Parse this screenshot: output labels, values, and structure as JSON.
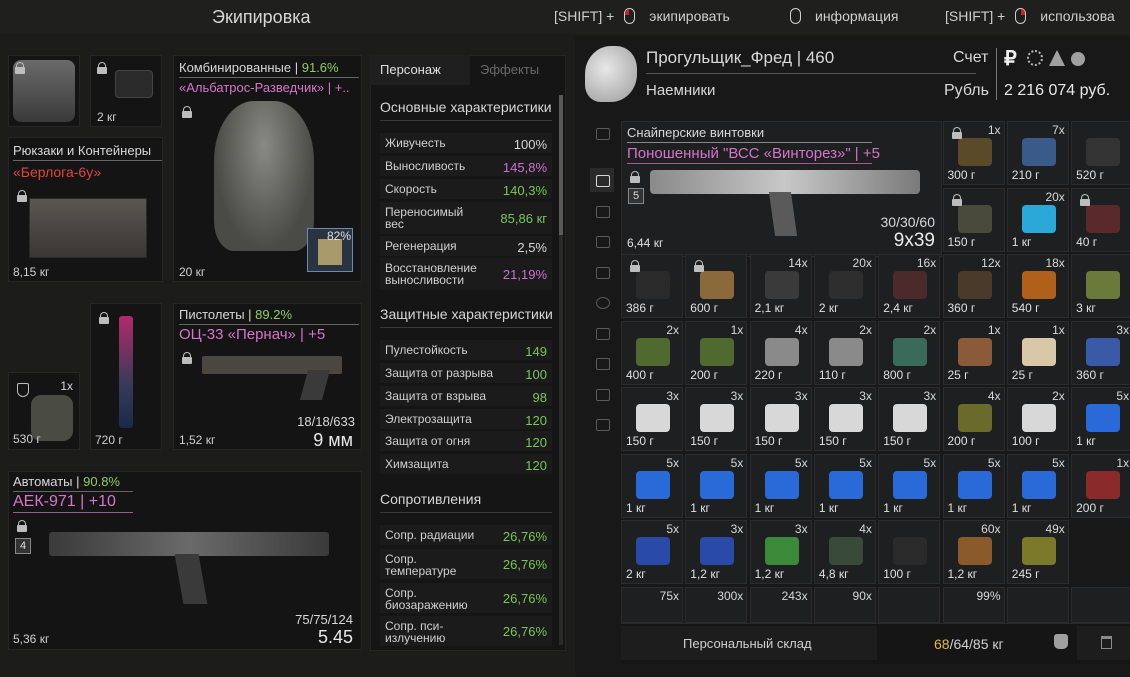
{
  "header": {
    "title": "Экипировка",
    "hints": [
      {
        "prefix": "[SHIFT] +",
        "mouse": "left",
        "label": "экипировать"
      },
      {
        "prefix": "",
        "mouse": "none",
        "label": "информация"
      },
      {
        "prefix": "[SHIFT] +",
        "mouse": "right",
        "label": "использова"
      }
    ]
  },
  "equipment": {
    "mask_weight": "",
    "nvd_weight": "2 кг",
    "armor": {
      "category": "Комбинированные",
      "durability": "91.6%",
      "name": "«Альбатрос-Разведчик» | +..",
      "weight": "20 кг",
      "container_fill": "82%"
    },
    "backpack": {
      "category": "Рюкзаки и Контейнеры",
      "name": "«Берлога-6у»",
      "weight": "8,15 кг"
    },
    "artifact": {
      "count": "1x",
      "weight": "530 г"
    },
    "knife": {
      "weight": "720 г"
    },
    "pistol": {
      "category": "Пистолеты",
      "durability": "89.2%",
      "name": "ОЦ-33 «Пернач» | +5",
      "weight": "1,52 кг",
      "ammo": "18/18/633",
      "caliber": "9 мм"
    },
    "rifle": {
      "category": "Автоматы",
      "durability": "90.8%",
      "name": "АЕК-971 | +10",
      "weight": "5,36 кг",
      "ammo": "75/75/124",
      "caliber": "5.45",
      "badge": "4"
    }
  },
  "stats": {
    "tabs": [
      "Персонаж",
      "Эффекты"
    ],
    "main_title": "Основные характеристики",
    "main": [
      {
        "label": "Живучесть",
        "value": "100%",
        "color": "white"
      },
      {
        "label": "Выносливость",
        "value": "145,8%",
        "color": "magenta"
      },
      {
        "label": "Скорость",
        "value": "140,3%",
        "color": "green"
      },
      {
        "label": "Переносимый вес",
        "value": "85,86 кг",
        "color": "green"
      },
      {
        "label": "Регенерация",
        "value": "2,5%",
        "color": "white"
      },
      {
        "label": "Восстановление выносливости",
        "value": "21,19%",
        "color": "magenta"
      }
    ],
    "protect_title": "Защитные характеристики",
    "protect": [
      {
        "label": "Пулестойкость",
        "value": "149"
      },
      {
        "label": "Защита от разрыва",
        "value": "100"
      },
      {
        "label": "Защита от взрыва",
        "value": "98"
      },
      {
        "label": "Электрозащита",
        "value": "120"
      },
      {
        "label": "Защита от огня",
        "value": "120"
      },
      {
        "label": "Химзащита",
        "value": "120"
      }
    ],
    "resist_title": "Сопротивления",
    "resist": [
      {
        "label": "Сопр. радиации",
        "value": "26,76%"
      },
      {
        "label": "Сопр. температуре",
        "value": "26,76%"
      },
      {
        "label": "Сопр. биозаражению",
        "value": "26,76%"
      },
      {
        "label": "Сопр. пси-излучению",
        "value": "26,76%"
      }
    ]
  },
  "player": {
    "name": "Прогульщик_Фред | 460",
    "faction": "Наемники",
    "account_label": "Счет",
    "currency_label": "Рубль",
    "balance": "2 216 074 руб."
  },
  "inventory": {
    "featured": {
      "category": "Снайперские винтовки",
      "name": "Поношенный \"ВСС «Винторез»\" | +5",
      "weight": "6,44 кг",
      "ammo": "30/30/60",
      "caliber": "9x39",
      "badge": "5"
    },
    "cells": [
      {
        "count": "1x",
        "weight": "300 г",
        "color": "#5b4a2a",
        "lock": true
      },
      {
        "count": "7x",
        "weight": "210 г",
        "color": "#3a5a8a",
        "lock": false
      },
      {
        "count": "",
        "weight": "520 г",
        "color": "#333333",
        "lock": false
      },
      {
        "count": "",
        "weight": "150 г",
        "color": "#4a4a3a",
        "lock": true
      },
      {
        "count": "20x",
        "weight": "1 кг",
        "color": "#2aa9d8",
        "lock": false
      },
      {
        "count": "",
        "weight": "40 г",
        "color": "#5a2a2a",
        "lock": true
      },
      {
        "count": "",
        "weight": "386 г",
        "color": "#2a2a2a",
        "lock": true
      },
      {
        "count": "",
        "weight": "600 г",
        "color": "#8a6a3a",
        "lock": true
      },
      {
        "count": "14x",
        "weight": "2,1 кг",
        "color": "#3a3a3a",
        "lock": false
      },
      {
        "count": "20x",
        "weight": "2 кг",
        "color": "#2e2e2e",
        "lock": false
      },
      {
        "count": "16x",
        "weight": "2,4 кг",
        "color": "#4a2a2a",
        "lock": false
      },
      {
        "count": "12x",
        "weight": "360 г",
        "color": "#4a3a2a",
        "lock": false
      },
      {
        "count": "18x",
        "weight": "540 г",
        "color": "#b0601a",
        "lock": false
      },
      {
        "count": "",
        "weight": "3 кг",
        "color": "#6a7a3a",
        "lock": false
      },
      {
        "count": "2x",
        "weight": "400 г",
        "color": "#4e6a2e",
        "lock": false
      },
      {
        "count": "1x",
        "weight": "200 г",
        "color": "#4e6a2e",
        "lock": false
      },
      {
        "count": "4x",
        "weight": "220 г",
        "color": "#8a8a8a",
        "lock": false
      },
      {
        "count": "2x",
        "weight": "110 г",
        "color": "#8a8a8a",
        "lock": false
      },
      {
        "count": "2x",
        "weight": "800 г",
        "color": "#3a6a5a",
        "lock": false
      },
      {
        "count": "1x",
        "weight": "25 г",
        "color": "#8a5a3a",
        "lock": false
      },
      {
        "count": "1x",
        "weight": "25 г",
        "color": "#d8c8a8",
        "lock": false
      },
      {
        "count": "3x",
        "weight": "360 г",
        "color": "#3a5aa8",
        "lock": false
      },
      {
        "count": "3x",
        "weight": "150 г",
        "color": "#d8d8d8",
        "lock": false
      },
      {
        "count": "3x",
        "weight": "150 г",
        "color": "#d8d8d8",
        "lock": false
      },
      {
        "count": "3x",
        "weight": "150 г",
        "color": "#d8d8d8",
        "lock": false
      },
      {
        "count": "3x",
        "weight": "150 г",
        "color": "#d8d8d8",
        "lock": false
      },
      {
        "count": "3x",
        "weight": "150 г",
        "color": "#d8d8d8",
        "lock": false
      },
      {
        "count": "4x",
        "weight": "200 г",
        "color": "#6a6a2a",
        "lock": false
      },
      {
        "count": "2x",
        "weight": "100 г",
        "color": "#d8d8d8",
        "lock": false
      },
      {
        "count": "5x",
        "weight": "1 кг",
        "color": "#2a6ad8",
        "lock": false
      },
      {
        "count": "5x",
        "weight": "1 кг",
        "color": "#2a6ad8",
        "lock": false
      },
      {
        "count": "5x",
        "weight": "1 кг",
        "color": "#2a6ad8",
        "lock": false
      },
      {
        "count": "5x",
        "weight": "1 кг",
        "color": "#2a6ad8",
        "lock": false
      },
      {
        "count": "5x",
        "weight": "1 кг",
        "color": "#2a6ad8",
        "lock": false
      },
      {
        "count": "5x",
        "weight": "1 кг",
        "color": "#2a6ad8",
        "lock": false
      },
      {
        "count": "5x",
        "weight": "1 кг",
        "color": "#2a6ad8",
        "lock": false
      },
      {
        "count": "5x",
        "weight": "1 кг",
        "color": "#2a6ad8",
        "lock": false
      },
      {
        "count": "1x",
        "weight": "200 г",
        "color": "#8a2a2a",
        "lock": false
      },
      {
        "count": "5x",
        "weight": "2 кг",
        "color": "#2a4aa8",
        "lock": false
      },
      {
        "count": "3x",
        "weight": "1,2 кг",
        "color": "#2a4aa8",
        "lock": false
      },
      {
        "count": "3x",
        "weight": "1,2 кг",
        "color": "#3a8a3a",
        "lock": false
      },
      {
        "count": "4x",
        "weight": "4,8 кг",
        "color": "#3a4a3a",
        "lock": false
      },
      {
        "count": "",
        "weight": "100 г",
        "color": "#2a2a2a",
        "lock": false
      },
      {
        "count": "60x",
        "weight": "1,2 кг",
        "color": "#8a5a2a",
        "lock": false
      },
      {
        "count": "49x",
        "weight": "245 г",
        "color": "#7a7a2a",
        "lock": false
      }
    ],
    "bottom_row_counts": [
      "75x",
      "300x",
      "243x",
      "90x",
      "",
      "99%",
      "",
      ""
    ]
  },
  "stash": {
    "label": "Персональный склад",
    "weight_current": "68",
    "weight_rest": "/64/85 кг"
  }
}
